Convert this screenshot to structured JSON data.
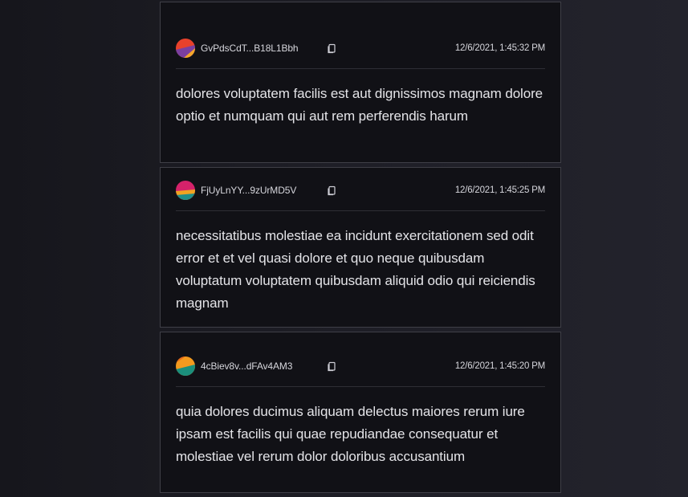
{
  "posts": [
    {
      "address": "GvPdsCdT...B18L1Bbh",
      "timestamp": "12/6/2021, 1:45:32 PM",
      "message": "dolores voluptatem facilis est aut dignissimos magnam dolore optio et numquam qui aut rem perferendis harum",
      "avatar_colors": [
        "#e8412b",
        "#7b3fa0",
        "#f4a62a"
      ]
    },
    {
      "address": "FjUyLnYY...9zUrMD5V",
      "timestamp": "12/6/2021, 1:45:25 PM",
      "message": "necessitatibus molestiae ea incidunt exercitationem sed odit error et et vel quasi dolore et quo neque quibusdam voluptatum voluptatem quibusdam aliquid odio qui reiciendis magnam",
      "avatar_colors": [
        "#d4226a",
        "#f0a322",
        "#1f8e8a"
      ]
    },
    {
      "address": "4cBiev8v...dFAv4AM3",
      "timestamp": "12/6/2021, 1:45:20 PM",
      "message": "quia dolores ducimus aliquam delectus maiores rerum iure ipsam est facilis qui quae repudiandae consequatur et molestiae vel rerum dolor doloribus accusantium",
      "avatar_colors": [
        "#f39a1e",
        "#1b8f7c",
        "#e86a1a"
      ]
    }
  ],
  "icons": {
    "copy": "copy-icon"
  }
}
